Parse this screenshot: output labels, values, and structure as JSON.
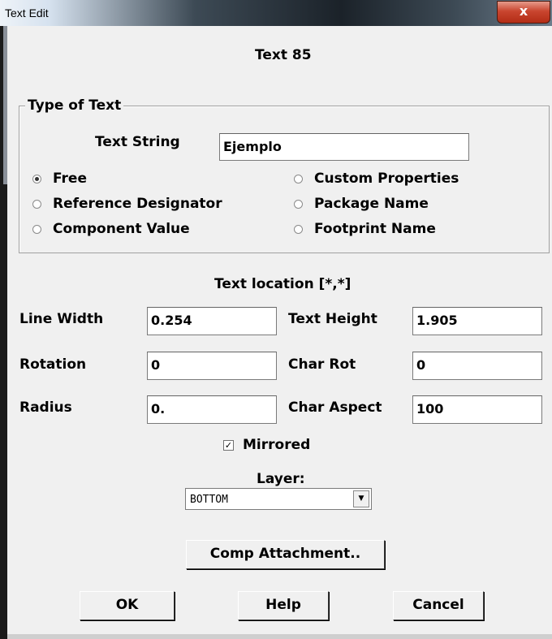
{
  "window": {
    "title": "Text Edit",
    "close_glyph": "x"
  },
  "header": {
    "text_id": "Text 85"
  },
  "type_of_text": {
    "legend": "Type of Text",
    "text_string_label": "Text String",
    "text_string_value": "Ejemplo",
    "options": [
      {
        "label": "Free",
        "checked": true
      },
      {
        "label": "Reference Designator",
        "checked": false
      },
      {
        "label": "Component Value",
        "checked": false
      },
      {
        "label": "Custom Properties",
        "checked": false
      },
      {
        "label": "Package Name",
        "checked": false
      },
      {
        "label": "Footprint Name",
        "checked": false
      }
    ]
  },
  "location": {
    "title": "Text location [*,*]",
    "line_width_label": "Line Width",
    "line_width": "0.254",
    "text_height_label": "Text Height",
    "text_height": "1.905",
    "rotation_label": "Rotation",
    "rotation": "0",
    "char_rot_label": "Char Rot",
    "char_rot": "0",
    "radius_label": "Radius",
    "radius": "0.",
    "char_aspect_label": "Char Aspect",
    "char_aspect": "100"
  },
  "mirrored": {
    "label": "Mirrored",
    "checked": true,
    "check_glyph": "✓"
  },
  "layer": {
    "label": "Layer:",
    "value": "BOTTOM",
    "arrow_glyph": "▼"
  },
  "buttons": {
    "comp_attachment": "Comp Attachment..",
    "ok": "OK",
    "help": "Help",
    "cancel": "Cancel"
  }
}
